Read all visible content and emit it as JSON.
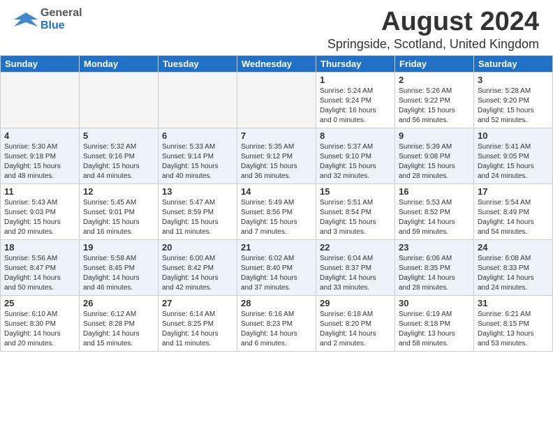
{
  "header": {
    "logo_general": "General",
    "logo_blue": "Blue",
    "month_title": "August 2024",
    "location": "Springside, Scotland, United Kingdom"
  },
  "days_of_week": [
    "Sunday",
    "Monday",
    "Tuesday",
    "Wednesday",
    "Thursday",
    "Friday",
    "Saturday"
  ],
  "weeks": [
    [
      {
        "day": "",
        "info": ""
      },
      {
        "day": "",
        "info": ""
      },
      {
        "day": "",
        "info": ""
      },
      {
        "day": "",
        "info": ""
      },
      {
        "day": "1",
        "info": "Sunrise: 5:24 AM\nSunset: 9:24 PM\nDaylight: 16 hours\nand 0 minutes."
      },
      {
        "day": "2",
        "info": "Sunrise: 5:26 AM\nSunset: 9:22 PM\nDaylight: 15 hours\nand 56 minutes."
      },
      {
        "day": "3",
        "info": "Sunrise: 5:28 AM\nSunset: 9:20 PM\nDaylight: 15 hours\nand 52 minutes."
      }
    ],
    [
      {
        "day": "4",
        "info": "Sunrise: 5:30 AM\nSunset: 9:18 PM\nDaylight: 15 hours\nand 48 minutes."
      },
      {
        "day": "5",
        "info": "Sunrise: 5:32 AM\nSunset: 9:16 PM\nDaylight: 15 hours\nand 44 minutes."
      },
      {
        "day": "6",
        "info": "Sunrise: 5:33 AM\nSunset: 9:14 PM\nDaylight: 15 hours\nand 40 minutes."
      },
      {
        "day": "7",
        "info": "Sunrise: 5:35 AM\nSunset: 9:12 PM\nDaylight: 15 hours\nand 36 minutes."
      },
      {
        "day": "8",
        "info": "Sunrise: 5:37 AM\nSunset: 9:10 PM\nDaylight: 15 hours\nand 32 minutes."
      },
      {
        "day": "9",
        "info": "Sunrise: 5:39 AM\nSunset: 9:08 PM\nDaylight: 15 hours\nand 28 minutes."
      },
      {
        "day": "10",
        "info": "Sunrise: 5:41 AM\nSunset: 9:05 PM\nDaylight: 15 hours\nand 24 minutes."
      }
    ],
    [
      {
        "day": "11",
        "info": "Sunrise: 5:43 AM\nSunset: 9:03 PM\nDaylight: 15 hours\nand 20 minutes."
      },
      {
        "day": "12",
        "info": "Sunrise: 5:45 AM\nSunset: 9:01 PM\nDaylight: 15 hours\nand 16 minutes."
      },
      {
        "day": "13",
        "info": "Sunrise: 5:47 AM\nSunset: 8:59 PM\nDaylight: 15 hours\nand 11 minutes."
      },
      {
        "day": "14",
        "info": "Sunrise: 5:49 AM\nSunset: 8:56 PM\nDaylight: 15 hours\nand 7 minutes."
      },
      {
        "day": "15",
        "info": "Sunrise: 5:51 AM\nSunset: 8:54 PM\nDaylight: 15 hours\nand 3 minutes."
      },
      {
        "day": "16",
        "info": "Sunrise: 5:53 AM\nSunset: 8:52 PM\nDaylight: 14 hours\nand 59 minutes."
      },
      {
        "day": "17",
        "info": "Sunrise: 5:54 AM\nSunset: 8:49 PM\nDaylight: 14 hours\nand 54 minutes."
      }
    ],
    [
      {
        "day": "18",
        "info": "Sunrise: 5:56 AM\nSunset: 8:47 PM\nDaylight: 14 hours\nand 50 minutes."
      },
      {
        "day": "19",
        "info": "Sunrise: 5:58 AM\nSunset: 8:45 PM\nDaylight: 14 hours\nand 46 minutes."
      },
      {
        "day": "20",
        "info": "Sunrise: 6:00 AM\nSunset: 8:42 PM\nDaylight: 14 hours\nand 42 minutes."
      },
      {
        "day": "21",
        "info": "Sunrise: 6:02 AM\nSunset: 8:40 PM\nDaylight: 14 hours\nand 37 minutes."
      },
      {
        "day": "22",
        "info": "Sunrise: 6:04 AM\nSunset: 8:37 PM\nDaylight: 14 hours\nand 33 minutes."
      },
      {
        "day": "23",
        "info": "Sunrise: 6:06 AM\nSunset: 8:35 PM\nDaylight: 14 hours\nand 28 minutes."
      },
      {
        "day": "24",
        "info": "Sunrise: 6:08 AM\nSunset: 8:33 PM\nDaylight: 14 hours\nand 24 minutes."
      }
    ],
    [
      {
        "day": "25",
        "info": "Sunrise: 6:10 AM\nSunset: 8:30 PM\nDaylight: 14 hours\nand 20 minutes."
      },
      {
        "day": "26",
        "info": "Sunrise: 6:12 AM\nSunset: 8:28 PM\nDaylight: 14 hours\nand 15 minutes."
      },
      {
        "day": "27",
        "info": "Sunrise: 6:14 AM\nSunset: 8:25 PM\nDaylight: 14 hours\nand 11 minutes."
      },
      {
        "day": "28",
        "info": "Sunrise: 6:16 AM\nSunset: 8:23 PM\nDaylight: 14 hours\nand 6 minutes."
      },
      {
        "day": "29",
        "info": "Sunrise: 6:18 AM\nSunset: 8:20 PM\nDaylight: 14 hours\nand 2 minutes."
      },
      {
        "day": "30",
        "info": "Sunrise: 6:19 AM\nSunset: 8:18 PM\nDaylight: 13 hours\nand 58 minutes."
      },
      {
        "day": "31",
        "info": "Sunrise: 6:21 AM\nSunset: 8:15 PM\nDaylight: 13 hours\nand 53 minutes."
      }
    ]
  ]
}
